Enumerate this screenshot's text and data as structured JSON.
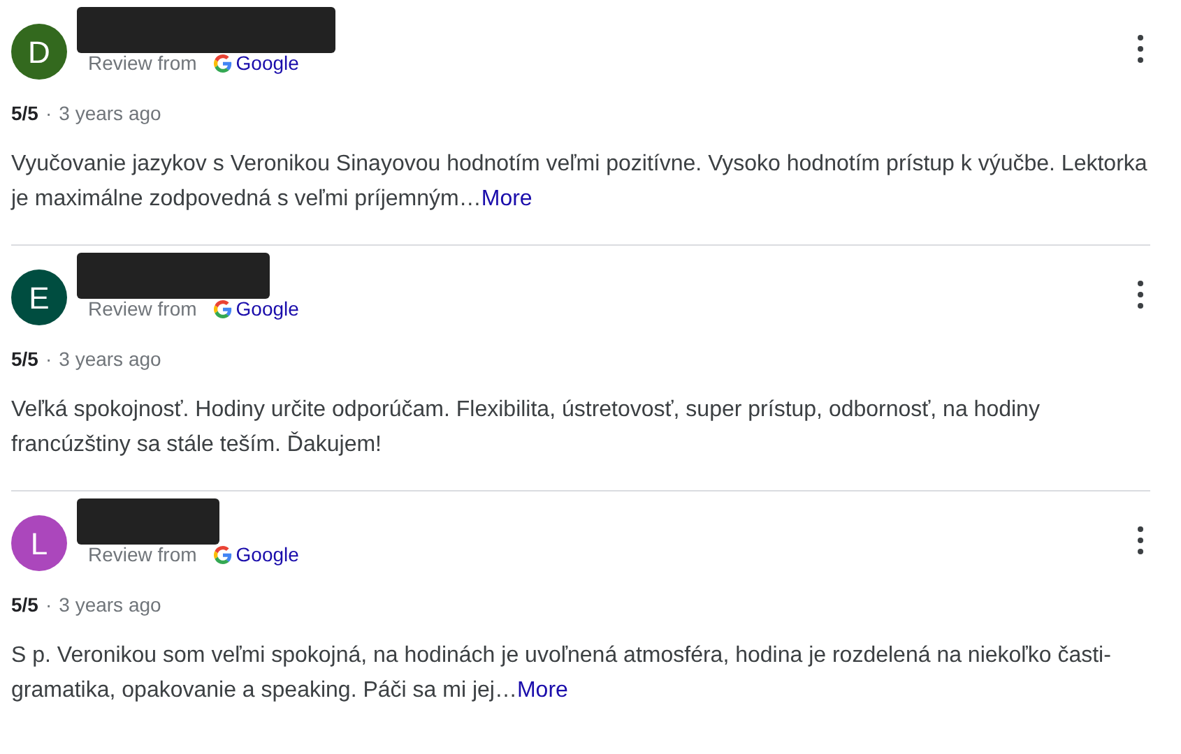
{
  "reviews": [
    {
      "initial": "D",
      "color": "#33691e",
      "source_label": "Review from",
      "source_name": "Google",
      "rating": "5/5",
      "separator": "·",
      "time": "3 years ago",
      "text": "Vyučovanie jazykov s Veronikou Sinayovou hodnotím veľmi pozitívne. Vysoko hodnotím prístup k výučbe. Lektorka je maximálne zodpovedná s veľmi príjemným…",
      "more": "More"
    },
    {
      "initial": "E",
      "color": "#004d40",
      "source_label": "Review from",
      "source_name": "Google",
      "rating": "5/5",
      "separator": "·",
      "time": "3 years ago",
      "text": "Veľká spokojnosť. Hodiny určite odporúčam. Flexibilita, ústretovosť, super prístup, odbornosť, na hodiny francúzštiny sa stále teším. Ďakujem!"
    },
    {
      "initial": "L",
      "color": "#ab47bc",
      "source_label": "Review from",
      "source_name": "Google",
      "rating": "5/5",
      "separator": "·",
      "time": "3 years ago",
      "text": "S p. Veronikou som veľmi spokojná, na hodinách je uvoľnená atmosféra, hodina je rozdelená na niekoľko časti-gramatika, opakovanie a speaking. Páči sa mi jej…",
      "more": "More"
    }
  ]
}
